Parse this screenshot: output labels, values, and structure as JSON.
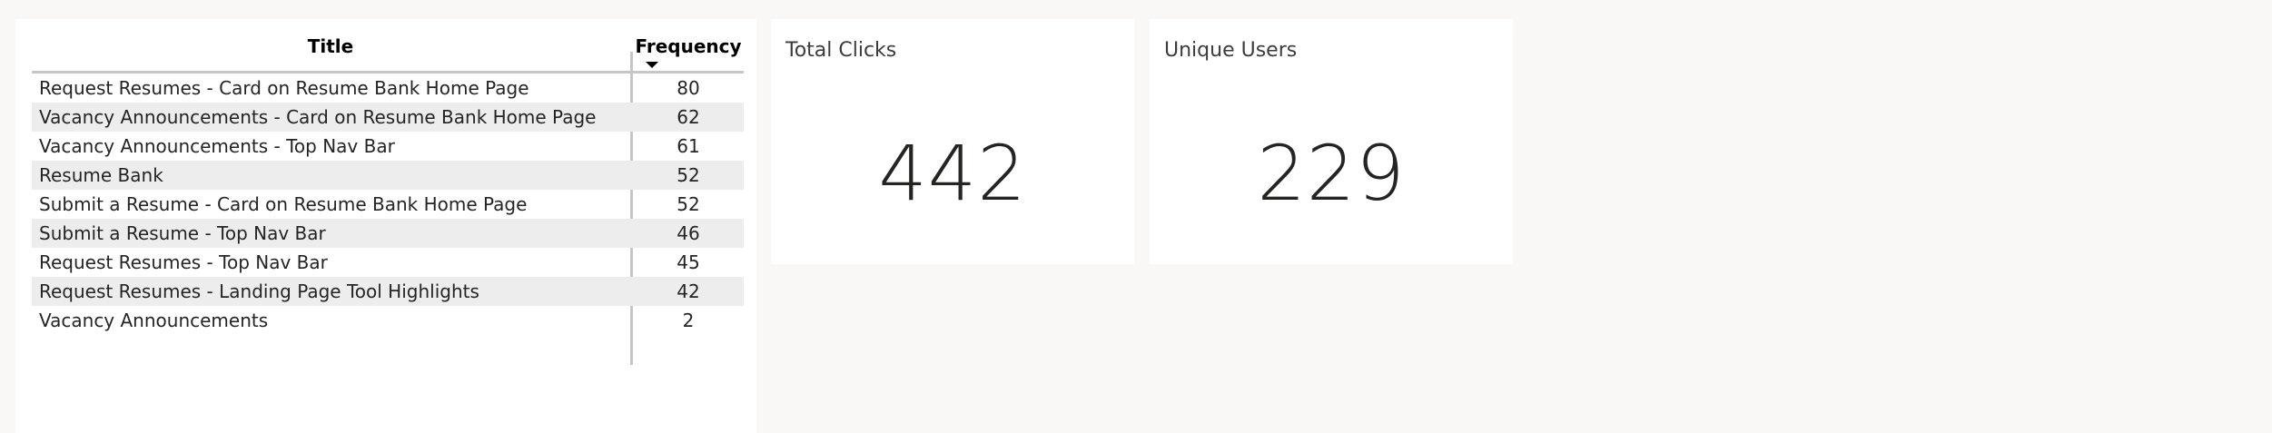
{
  "table": {
    "headers": {
      "title": "Title",
      "frequency": "Frequency"
    },
    "sort_icon": "sort-descending-icon",
    "rows": [
      {
        "title": "Request Resumes - Card on Resume Bank Home Page",
        "frequency": "80"
      },
      {
        "title": "Vacancy Announcements - Card on Resume Bank Home Page",
        "frequency": "62"
      },
      {
        "title": "Vacancy Announcements - Top Nav Bar",
        "frequency": "61"
      },
      {
        "title": "Resume Bank",
        "frequency": "52"
      },
      {
        "title": "Submit a Resume - Card on Resume Bank Home Page",
        "frequency": "52"
      },
      {
        "title": "Submit a Resume - Top Nav Bar",
        "frequency": "46"
      },
      {
        "title": "Request Resumes - Top Nav Bar",
        "frequency": "45"
      },
      {
        "title": "Request Resumes - Landing Page Tool Highlights",
        "frequency": "42"
      },
      {
        "title": "Vacancy Announcements",
        "frequency": "2"
      }
    ]
  },
  "cards": {
    "total_clicks": {
      "label": "Total Clicks",
      "value": "442"
    },
    "unique_users": {
      "label": "Unique Users",
      "value": "229"
    }
  },
  "colors": {
    "canvas": "#f9f8f7",
    "visual_background": "#ffffff",
    "alt_row": "#ededed",
    "divider": "#c8c6c4",
    "text": "#252423"
  }
}
